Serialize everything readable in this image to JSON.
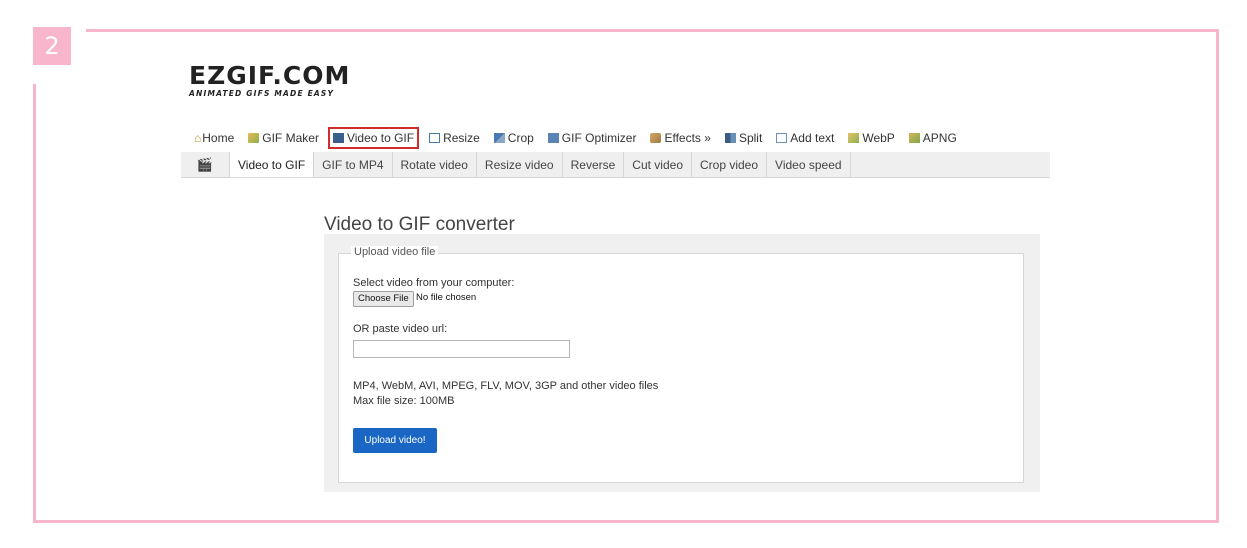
{
  "step_badge": "2",
  "logo": {
    "main": "EZGIF.COM",
    "tagline": "ANIMATED GIFS MADE EASY"
  },
  "nav": [
    {
      "label": "Home",
      "icon": "home-icon"
    },
    {
      "label": "GIF Maker",
      "icon": "gif-maker-icon"
    },
    {
      "label": "Video to GIF",
      "icon": "film-icon",
      "active": true
    },
    {
      "label": "Resize",
      "icon": "resize-icon"
    },
    {
      "label": "Crop",
      "icon": "crop-icon"
    },
    {
      "label": "GIF Optimizer",
      "icon": "optimizer-icon"
    },
    {
      "label": "Effects »",
      "icon": "effects-icon"
    },
    {
      "label": "Split",
      "icon": "split-icon"
    },
    {
      "label": "Add text",
      "icon": "add-text-icon"
    },
    {
      "label": "WebP",
      "icon": "webp-icon"
    },
    {
      "label": "APNG",
      "icon": "apng-icon"
    }
  ],
  "subnav": [
    {
      "label": "Video to GIF",
      "active": true
    },
    {
      "label": "GIF to MP4"
    },
    {
      "label": "Rotate video"
    },
    {
      "label": "Resize video"
    },
    {
      "label": "Reverse"
    },
    {
      "label": "Cut video"
    },
    {
      "label": "Crop video"
    },
    {
      "label": "Video speed"
    }
  ],
  "page_title": "Video to GIF converter",
  "form": {
    "legend": "Upload video file",
    "select_label": "Select video from your computer:",
    "choose_button": "Choose File",
    "file_status": "No file chosen",
    "url_label": "OR paste video url:",
    "url_value": "",
    "formats_note": "MP4, WebM, AVI, MPEG, FLV, MOV, 3GP and other video files",
    "max_size": "Max file size: 100MB",
    "upload_button": "Upload video!"
  },
  "colors": {
    "frame": "#f7b6cb",
    "highlight": "#d02c2c",
    "primary_button": "#1a66c4"
  }
}
